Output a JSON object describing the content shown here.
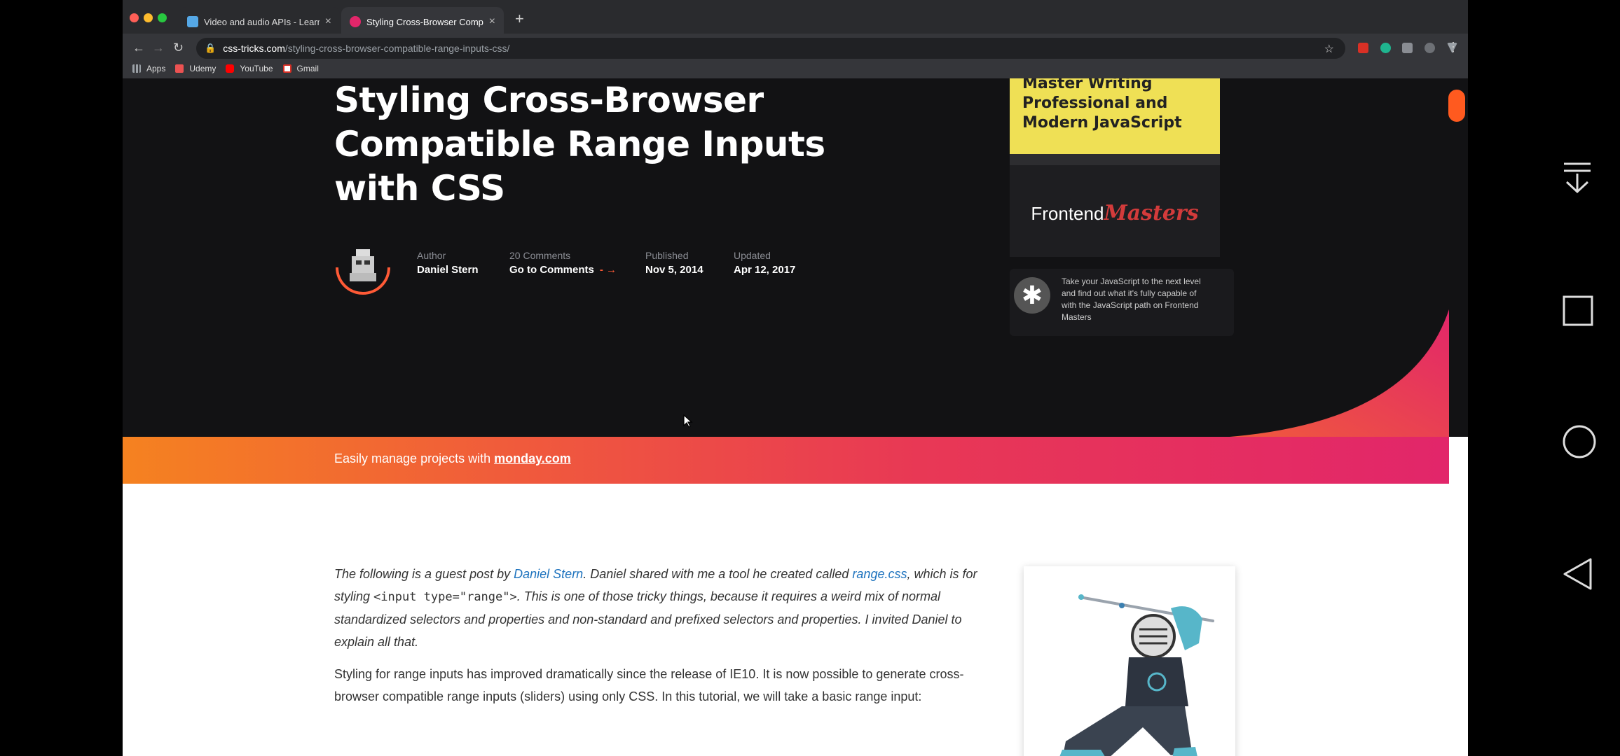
{
  "browser": {
    "tabs": [
      {
        "title": "Video and audio APIs - Learn we",
        "active": false
      },
      {
        "title": "Styling Cross-Browser Compatib",
        "active": true
      }
    ],
    "close_glyph": "×",
    "new_tab_glyph": "+",
    "address": {
      "domain": "css-tricks.com",
      "path": "/styling-cross-browser-compatible-range-inputs-css/"
    },
    "bookmarks": [
      "Apps",
      "Udemy",
      "YouTube",
      "Gmail"
    ]
  },
  "article": {
    "title": "Styling Cross-Browser Compatible Range Inputs with CSS",
    "meta": {
      "author_label": "Author",
      "author": "Daniel Stern",
      "comments_label": "20 Comments",
      "comments_link": "Go to Comments",
      "published_label": "Published",
      "published": "Nov 5, 2014",
      "updated_label": "Updated",
      "updated": "Apr 12, 2017"
    },
    "intro": {
      "t1": "The following is a guest post by ",
      "author_link": "Daniel Stern",
      "t2": ". Daniel shared with me a tool he created called ",
      "tool_link": "range.css",
      "t3": ", which is for styling ",
      "code": "<input type=\"range\">",
      "t4": ". This is one of those tricky things, because it requires a weird mix of normal standardized selectors and properties and non-standard and prefixed selectors and properties. I invited Daniel to explain all that."
    },
    "paragraph": "Styling for range inputs has improved dramatically since the release of IE10. It is now possible to generate cross-browser compatible range inputs (sliders) using only CSS. In this tutorial, we will take a basic range input:"
  },
  "ad": {
    "headline": "Master Writing Professional and Modern JavaScript",
    "logo_plain": "Frontend",
    "logo_script": "Masters",
    "copy": "Take your JavaScript to the next level and find out what it's fully capable of with the JavaScript path on Frontend Masters"
  },
  "banner": {
    "prefix": "Easily manage projects with ",
    "link": "monday.com"
  },
  "colors": {
    "hero_bg": "#121214",
    "accent_orange": "#f58220",
    "accent_pink": "#e2266a",
    "link_blue": "#1e73be"
  }
}
